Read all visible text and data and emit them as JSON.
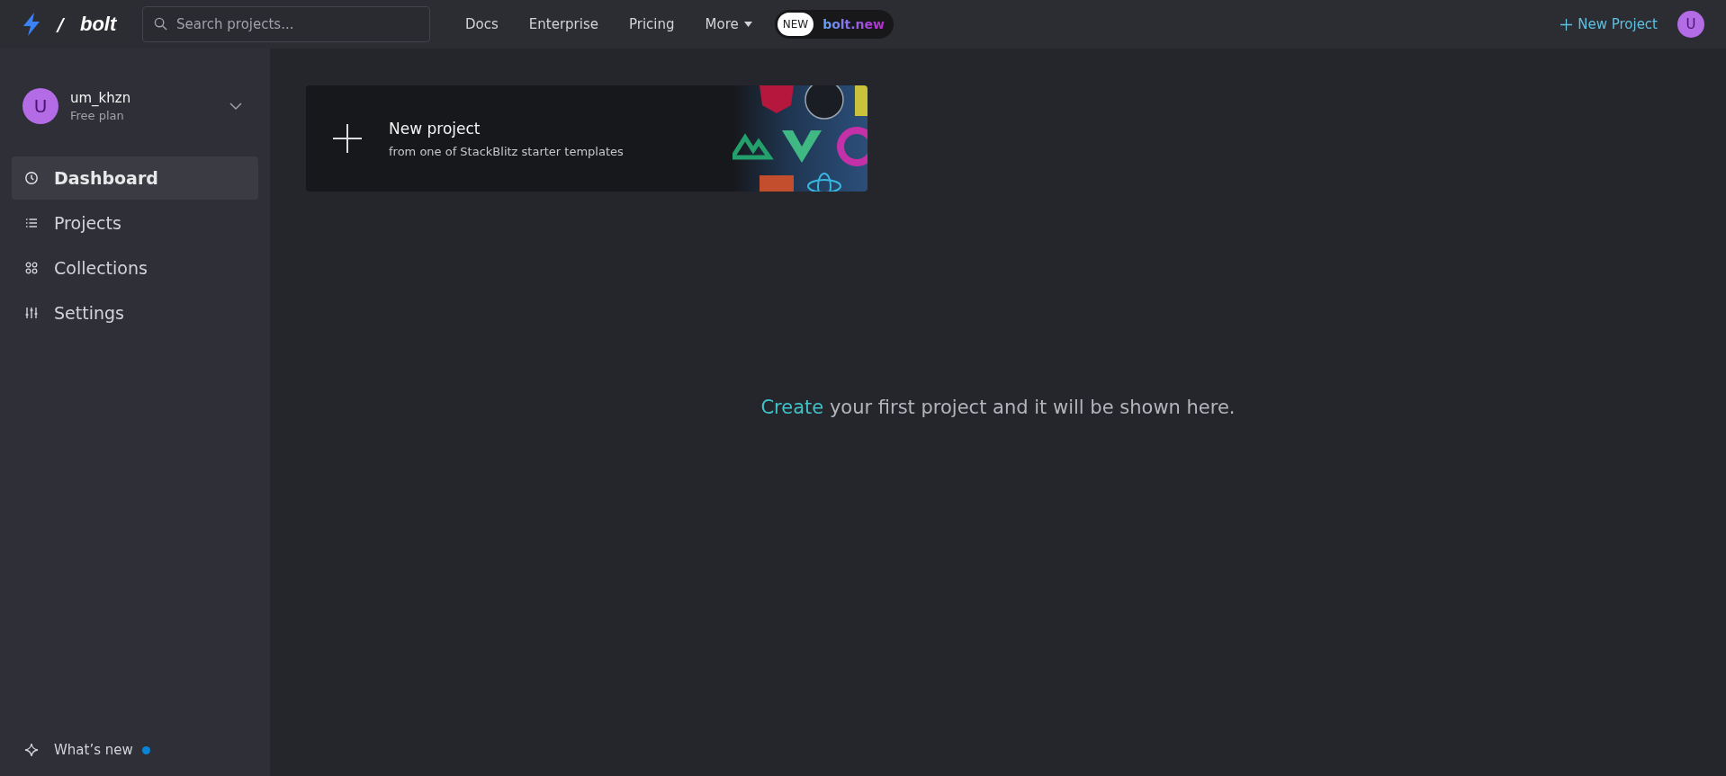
{
  "topbar": {
    "brand": "bolt",
    "separator": "/",
    "search": {
      "placeholder": "Search projects..."
    },
    "nav": [
      {
        "label": "Docs",
        "kind": "link"
      },
      {
        "label": "Enterprise",
        "kind": "link"
      },
      {
        "label": "Pricing",
        "kind": "link"
      },
      {
        "label": "More",
        "kind": "dropdown"
      }
    ],
    "promo": {
      "badge": "NEW",
      "label": "bolt.new"
    },
    "new_project": "New Project",
    "avatar": "U"
  },
  "sidebar": {
    "user": {
      "avatar": "U",
      "name": "um_khzn",
      "plan": "Free plan"
    },
    "items": [
      {
        "label": "Dashboard",
        "kind": "clock",
        "selected": true
      },
      {
        "label": "Projects",
        "kind": "list",
        "selected": false
      },
      {
        "label": "Collections",
        "kind": "grid",
        "selected": false
      },
      {
        "label": "Settings",
        "kind": "sliders",
        "selected": false
      }
    ],
    "footer": {
      "label": "What’s new",
      "unread": true
    }
  },
  "main": {
    "card": {
      "title": "New project",
      "subtitle": "from one of StackBlitz starter templates"
    },
    "empty_state": {
      "link": "Create",
      "text": "your first project and it will be shown here."
    }
  }
}
